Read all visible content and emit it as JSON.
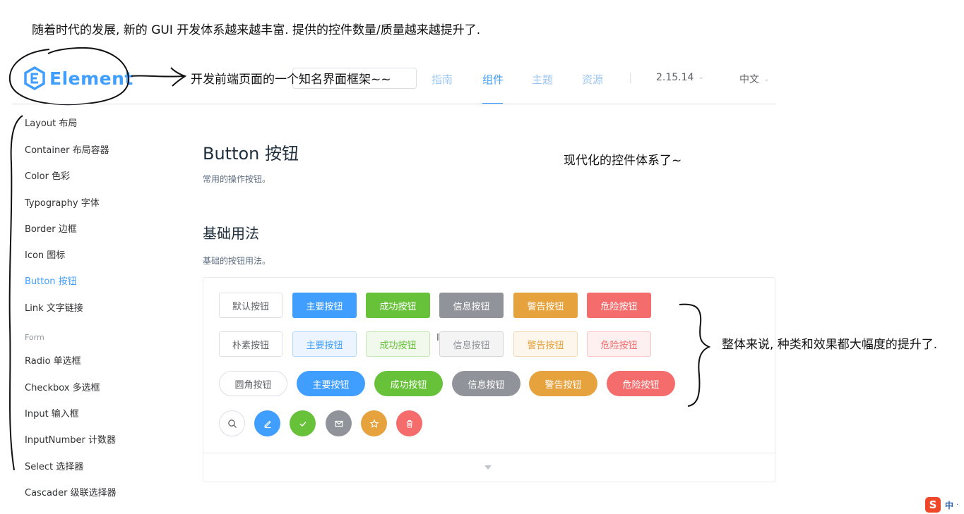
{
  "annotations": {
    "top_note": "随着时代的发展, 新的 GUI 开发体系越来越丰富. 提供的控件数量/质量越来越提升了.",
    "frame_note": "开发前端页面的一个知名界面框架~~",
    "modern_note": "现代化的控件体系了~",
    "overall_note": "整体来说, 种类和效果都大幅度的提升了."
  },
  "header": {
    "logo_text": "Element",
    "nav": [
      {
        "label": "指南"
      },
      {
        "label": "组件"
      },
      {
        "label": "主题"
      },
      {
        "label": "资源"
      }
    ],
    "version": "2.15.14",
    "language": "中文"
  },
  "sidebar": {
    "items": [
      {
        "label": "Layout 布局"
      },
      {
        "label": "Container 布局容器"
      },
      {
        "label": "Color 色彩"
      },
      {
        "label": "Typography 字体"
      },
      {
        "label": "Border 边框"
      },
      {
        "label": "Icon 图标"
      },
      {
        "label": "Button 按钮"
      },
      {
        "label": "Link 文字链接"
      },
      {
        "label": "Radio 单选框"
      },
      {
        "label": "Checkbox 多选框"
      },
      {
        "label": "Input 输入框"
      },
      {
        "label": "InputNumber 计数器"
      },
      {
        "label": "Select 选择器"
      },
      {
        "label": "Cascader 级联选择器"
      }
    ],
    "group_label": "Form",
    "active_item": "Button 按钮"
  },
  "main": {
    "title": "Button 按钮",
    "description": "常用的操作按钮。",
    "section_title": "基础用法",
    "section_description": "基础的按钮用法。"
  },
  "buttons": {
    "row1": [
      "默认按钮",
      "主要按钮",
      "成功按钮",
      "信息按钮",
      "警告按钮",
      "危险按钮"
    ],
    "row2": [
      "朴素按钮",
      "主要按钮",
      "成功按钮",
      "信息按钮",
      "警告按钮",
      "危险按钮"
    ],
    "row3": [
      "圆角按钮",
      "主要按钮",
      "成功按钮",
      "信息按钮",
      "警告按钮",
      "危险按钮"
    ],
    "row4_icons": [
      "search-icon",
      "edit-icon",
      "check-icon",
      "message-icon",
      "star-icon",
      "delete-icon"
    ]
  },
  "colors": {
    "primary": "#409eff",
    "success": "#67c23a",
    "info": "#909399",
    "warning": "#e6a23c",
    "danger": "#f56c6c"
  },
  "ime": {
    "logo": "S",
    "text": "中"
  }
}
